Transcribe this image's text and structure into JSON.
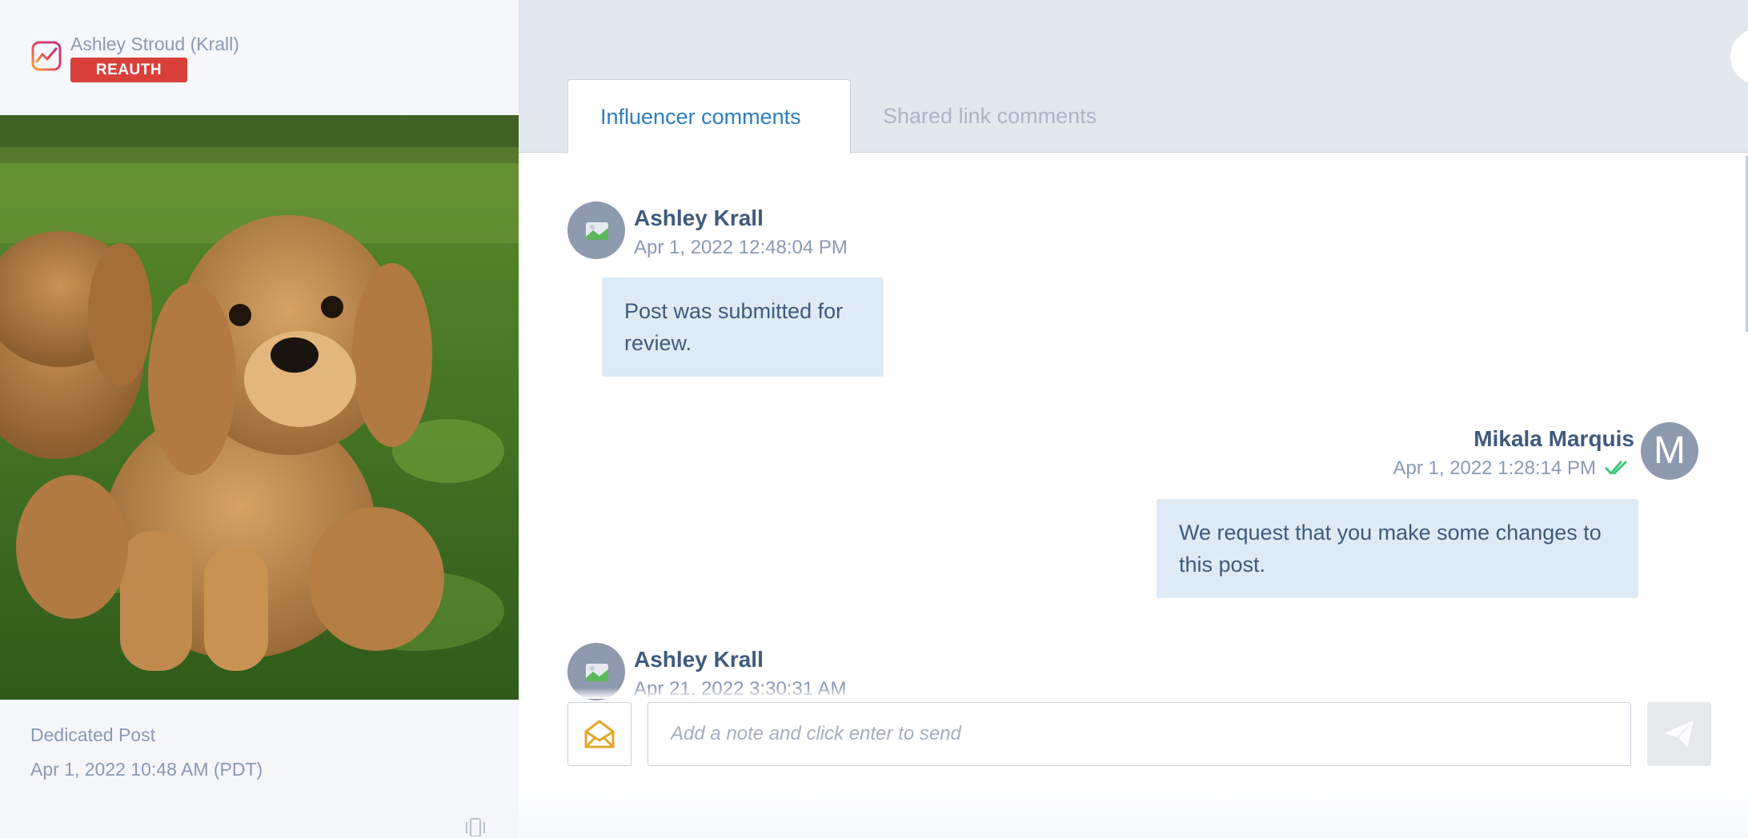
{
  "account": {
    "name": "Ashley Stroud (Krall)",
    "reauth_label": "REAUTH"
  },
  "post": {
    "type": "Dedicated Post",
    "date": "Apr 1, 2022 10:48 AM (PDT)",
    "image_alt": "puppies on grass"
  },
  "tabs": [
    {
      "label": "Influencer comments",
      "active": true
    },
    {
      "label": "Shared link comments",
      "active": false
    }
  ],
  "comments": [
    {
      "author": "Ashley Krall",
      "time": "Apr 1, 2022 12:48:04 PM",
      "text": "Post was submitted for review.",
      "side": "left"
    },
    {
      "author": "Mikala Marquis",
      "avatar_letter": "M",
      "time": "Apr 1, 2022 1:28:14 PM",
      "text": "We request that you make some changes to this post.",
      "side": "right",
      "status": "read"
    },
    {
      "author": "Ashley Krall",
      "time": "Apr 21, 2022 3:30:31 AM",
      "side": "left"
    }
  ],
  "composer": {
    "placeholder": "Add a note and click enter to send",
    "note_icon": "envelope-open-icon",
    "send_icon": "paper-plane-icon"
  },
  "colors": {
    "accent": "#2e7dc1",
    "reauth": "#d9403a",
    "bubble": "#deebf6",
    "read_check": "#3cc47c",
    "note_icon": "#e0a92c"
  }
}
